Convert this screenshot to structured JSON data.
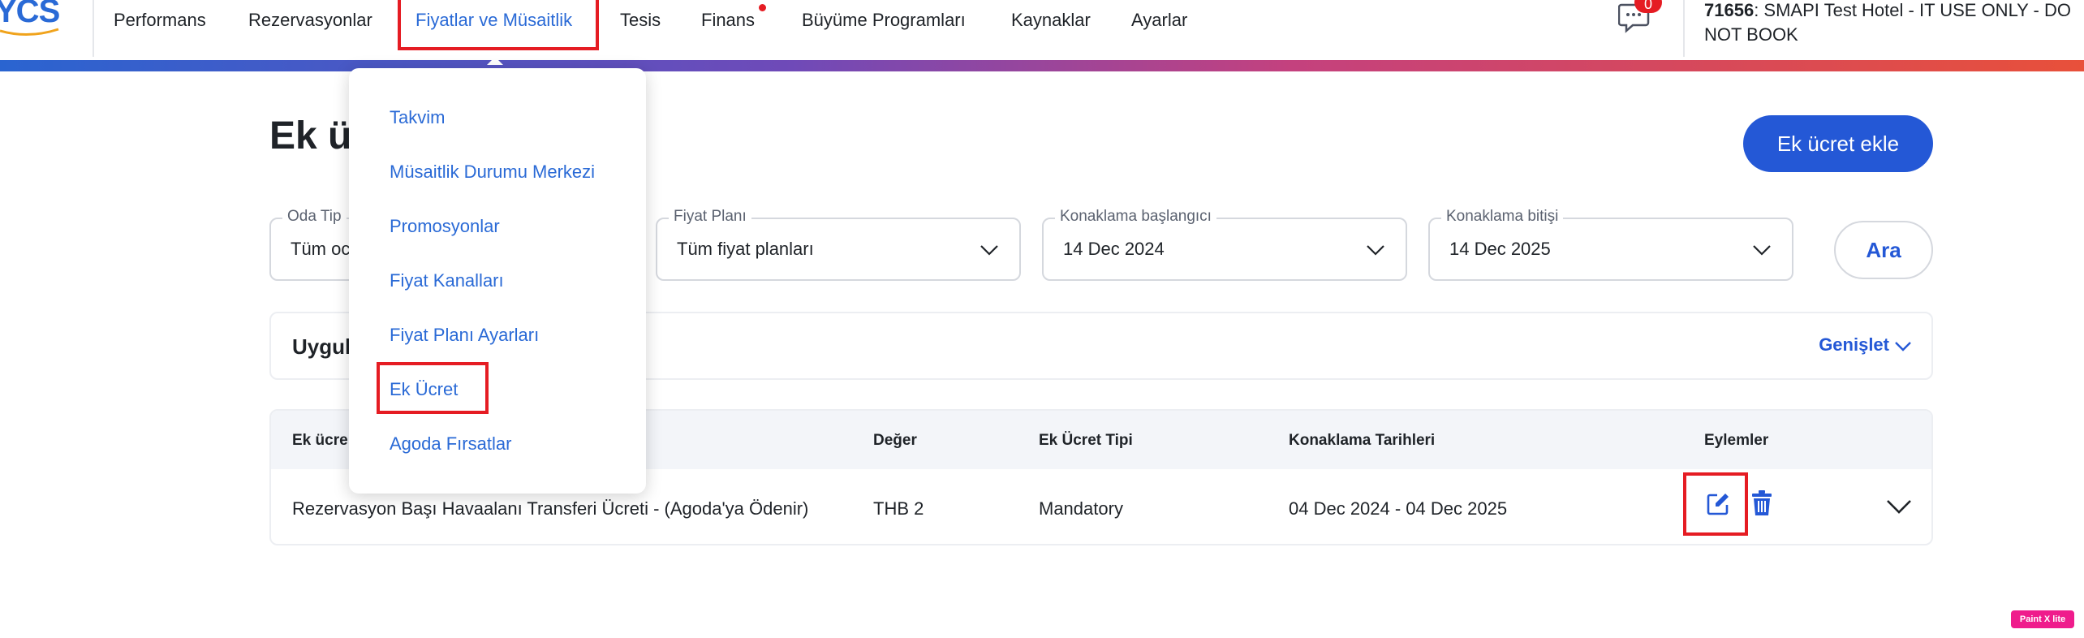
{
  "brand": {
    "logo_text": "YCS"
  },
  "nav": {
    "items": [
      {
        "label": "Performans"
      },
      {
        "label": "Rezervasyonlar"
      },
      {
        "label": "Fiyatlar ve Müsaitlik"
      },
      {
        "label": "Tesis"
      },
      {
        "label": "Finans"
      },
      {
        "label": "Büyüme Programları"
      },
      {
        "label": "Kaynaklar"
      },
      {
        "label": "Ayarlar"
      }
    ],
    "active": "Fiyatlar ve Müsaitlik",
    "messages_badge": "0",
    "hotel_id": "71656",
    "hotel_name": ": SMAPI Test Hotel - IT USE ONLY - DO NOT BOOK"
  },
  "dropdown": {
    "items": [
      {
        "label": "Takvim"
      },
      {
        "label": "Müsaitlik Durumu Merkezi"
      },
      {
        "label": "Promosyonlar"
      },
      {
        "label": "Fiyat Kanalları"
      },
      {
        "label": "Fiyat Planı Ayarları"
      },
      {
        "label": "Ek Ücret"
      },
      {
        "label": "Agoda Fırsatlar"
      }
    ],
    "highlighted": "Ek Ücret"
  },
  "page": {
    "title": "Ek üc",
    "add_button": "Ek ücret ekle"
  },
  "filters": {
    "room_type": {
      "label": "Oda Tip",
      "value": "Tüm oc"
    },
    "rate_plan": {
      "label": "Fiyat Planı",
      "value": "Tüm fiyat planları"
    },
    "stay_start": {
      "label": "Konaklama başlangıcı",
      "value": "14 Dec 2024"
    },
    "stay_end": {
      "label": "Konaklama bitişi",
      "value": "14 Dec 2025"
    },
    "search_button": "Ara"
  },
  "panel": {
    "title": "Uygul",
    "expand_label": "Genişlet"
  },
  "table": {
    "headers": [
      "Ek ücre",
      "Değer",
      "Ek Ücret Tipi",
      "Konaklama Tarihleri",
      "Eylemler"
    ],
    "rows": [
      {
        "name": "Rezervasyon Başı Havaalanı Transferi Ücreti - (Agoda'ya Ödenir)",
        "value": "THB 2",
        "type": "Mandatory",
        "dates": "04 Dec 2024 - 04 Dec 2025"
      }
    ]
  },
  "colors": {
    "brand_blue": "#2458d6",
    "link_blue": "#2a6ad6",
    "highlight_red": "#e51c23"
  },
  "watermark": "Paint X lite"
}
